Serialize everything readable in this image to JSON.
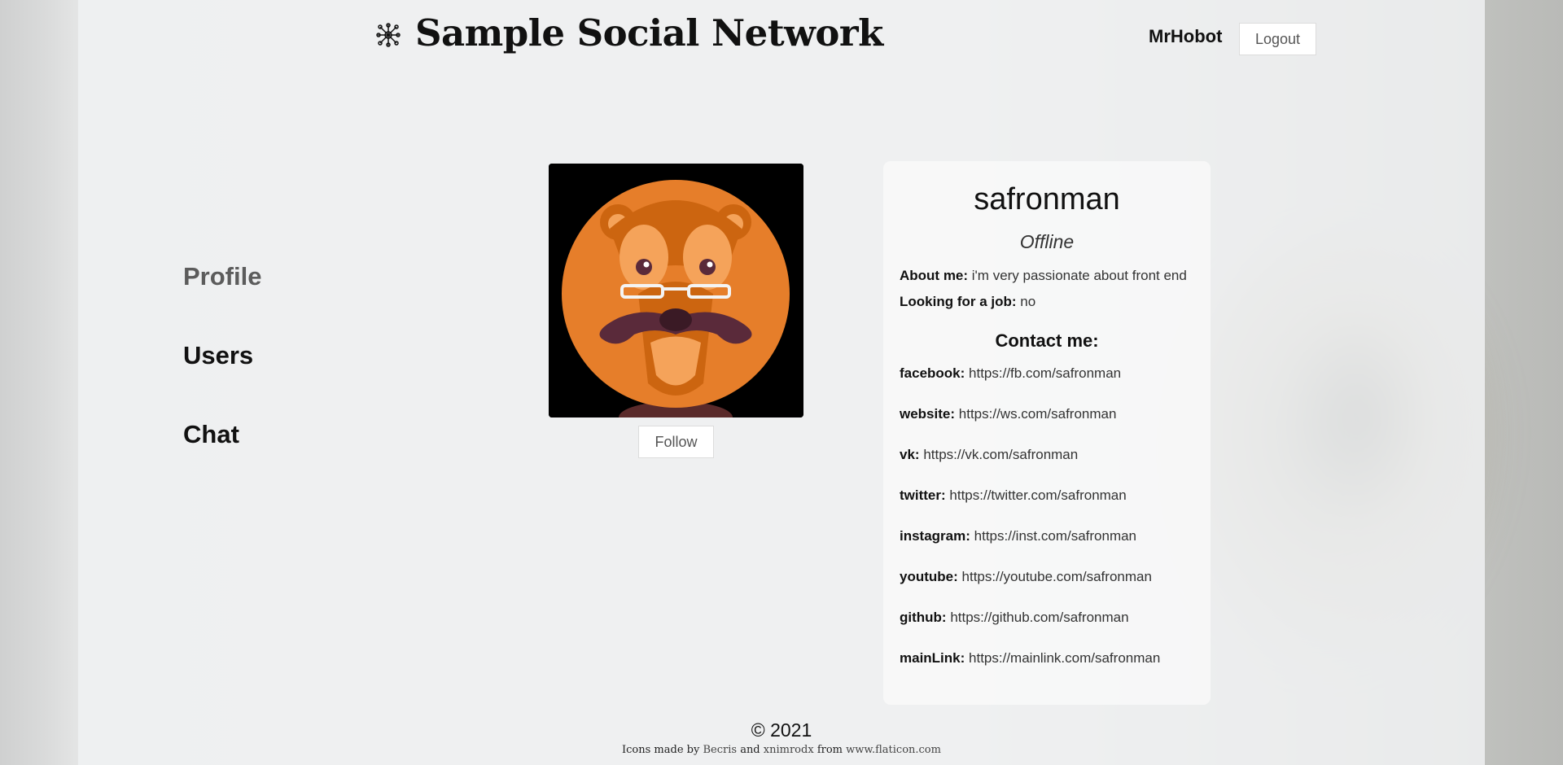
{
  "header": {
    "site_title": "Sample Social Network",
    "logo_icon": "network-node-icon",
    "username": "MrHobot",
    "logout_label": "Logout"
  },
  "sidebar": {
    "items": [
      {
        "label": "Profile",
        "active": true
      },
      {
        "label": "Users",
        "active": false
      },
      {
        "label": "Chat",
        "active": false
      }
    ]
  },
  "profile": {
    "avatar_icon": "lion-with-glasses-and-mustache-avatar",
    "follow_label": "Follow",
    "name": "safronman",
    "status": "Offline",
    "about_label": "About me:",
    "about_value": "i'm very passionate about front end",
    "job_label": "Looking for a job:",
    "job_value": "no",
    "contact_title": "Contact me:",
    "contacts": [
      {
        "label": "facebook:",
        "value": "https://fb.com/safronman"
      },
      {
        "label": "website:",
        "value": "https://ws.com/safronman"
      },
      {
        "label": "vk:",
        "value": "https://vk.com/safronman"
      },
      {
        "label": "twitter:",
        "value": "https://twitter.com/safronman"
      },
      {
        "label": "instagram:",
        "value": "https://inst.com/safronman"
      },
      {
        "label": "youtube:",
        "value": "https://youtube.com/safronman"
      },
      {
        "label": "github:",
        "value": "https://github.com/safronman"
      },
      {
        "label": "mainLink:",
        "value": "https://mainlink.com/safronman"
      }
    ]
  },
  "footer": {
    "copyright": "© 2021",
    "credits_prefix": "Icons made by",
    "author1": "Becris",
    "and": "and",
    "author2": "xnimrodx",
    "from": "from",
    "site": "www.flaticon.com"
  },
  "colors": {
    "active_nav": "#5c5c5c",
    "avatar_orange": "#e67e2a",
    "card_bg": "#fafafa"
  }
}
